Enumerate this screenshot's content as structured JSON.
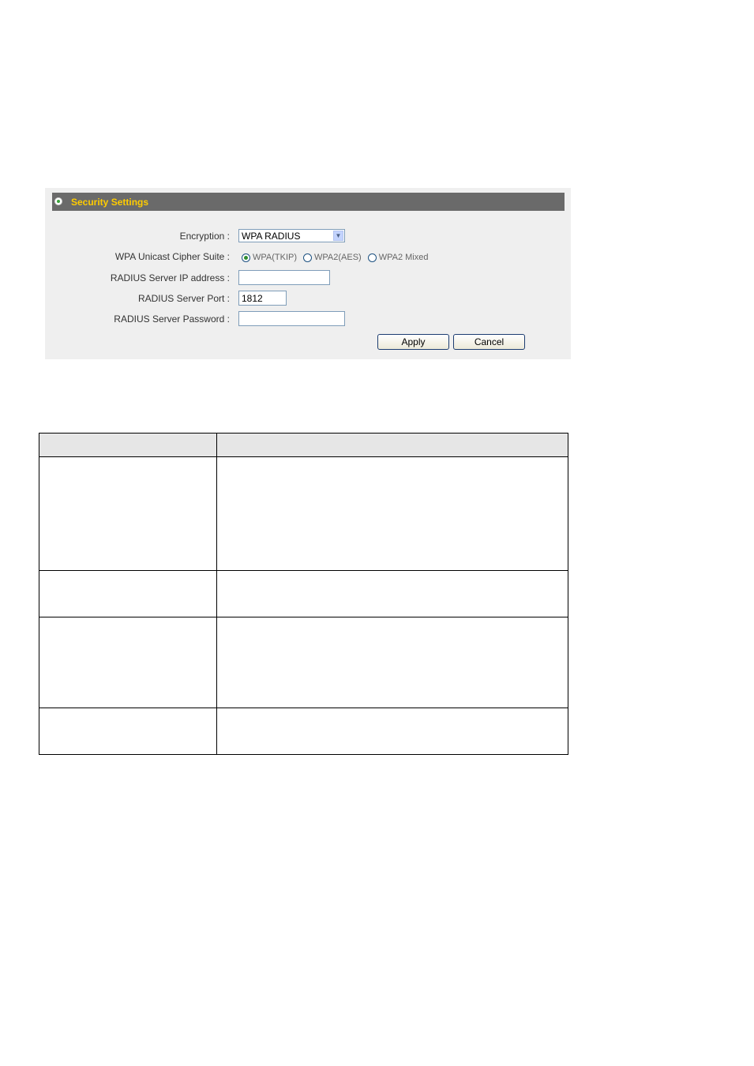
{
  "panel": {
    "title": "Security Settings",
    "fields": {
      "encryption_label": "Encryption :",
      "encryption_value": "WPA RADIUS",
      "cipher_label": "WPA Unicast Cipher Suite :",
      "cipher_options": [
        {
          "label": "WPA(TKIP)",
          "checked": true
        },
        {
          "label": "WPA2(AES)",
          "checked": false
        },
        {
          "label": "WPA2 Mixed",
          "checked": false
        }
      ],
      "radius_ip_label": "RADIUS Server IP address :",
      "radius_ip_value": "",
      "radius_port_label": "RADIUS Server Port :",
      "radius_port_value": "1812",
      "radius_password_label": "RADIUS Server Password :",
      "radius_password_value": ""
    },
    "buttons": {
      "apply": "Apply",
      "cancel": "Cancel"
    }
  },
  "table": {
    "header": [
      "",
      ""
    ],
    "rows": [
      [
        "",
        ""
      ],
      [
        "",
        ""
      ],
      [
        "",
        ""
      ],
      [
        "",
        ""
      ]
    ]
  }
}
